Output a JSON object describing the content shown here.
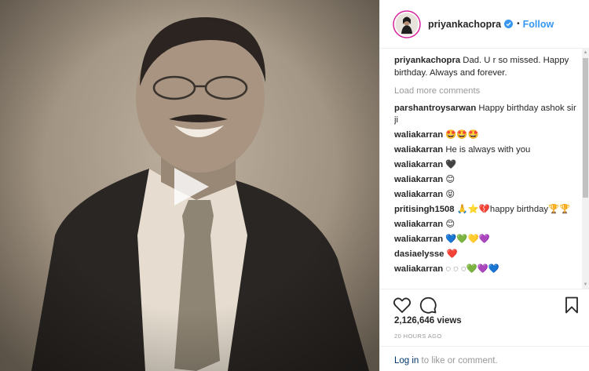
{
  "post": {
    "username": "priyankachopra",
    "follow_label": "Follow",
    "separator": "•",
    "caption_text": "Dad. U r so missed. Happy birthday. Always and forever.",
    "load_more": "Load more comments",
    "comments": [
      {
        "user": "parshantroysarwan",
        "text": "Happy birthday ashok sir ji"
      },
      {
        "user": "waliakarran",
        "text": "🤩🤩🤩"
      },
      {
        "user": "waliakarran",
        "text": "He is always with you"
      },
      {
        "user": "waliakarran",
        "text": "🖤"
      },
      {
        "user": "waliakarran",
        "text": "😊"
      },
      {
        "user": "waliakarran",
        "text": "😝"
      },
      {
        "user": "pritisingh1508",
        "text": "🙏⭐💔happy birthday🏆🏆"
      },
      {
        "user": "waliakarran",
        "text": "😊"
      },
      {
        "user": "waliakarran",
        "text": "💙💚💛💜"
      },
      {
        "user": "dasiaelysse",
        "text": "❤️"
      },
      {
        "user": "waliakarran",
        "text": "◌ ◌ ◌💚💜💙"
      }
    ],
    "views": "2,126,646 views",
    "time": "20 HOURS AGO",
    "login_link": "Log in",
    "login_rest": " to like or comment.",
    "icons": {
      "like": "heart-icon",
      "comment": "comment-bubble-icon",
      "save": "bookmark-icon",
      "play": "play-icon",
      "verified": "verified-badge-icon"
    },
    "colors": {
      "link": "#3897f0",
      "login": "#003569",
      "muted": "#999999",
      "text": "#262626"
    }
  }
}
